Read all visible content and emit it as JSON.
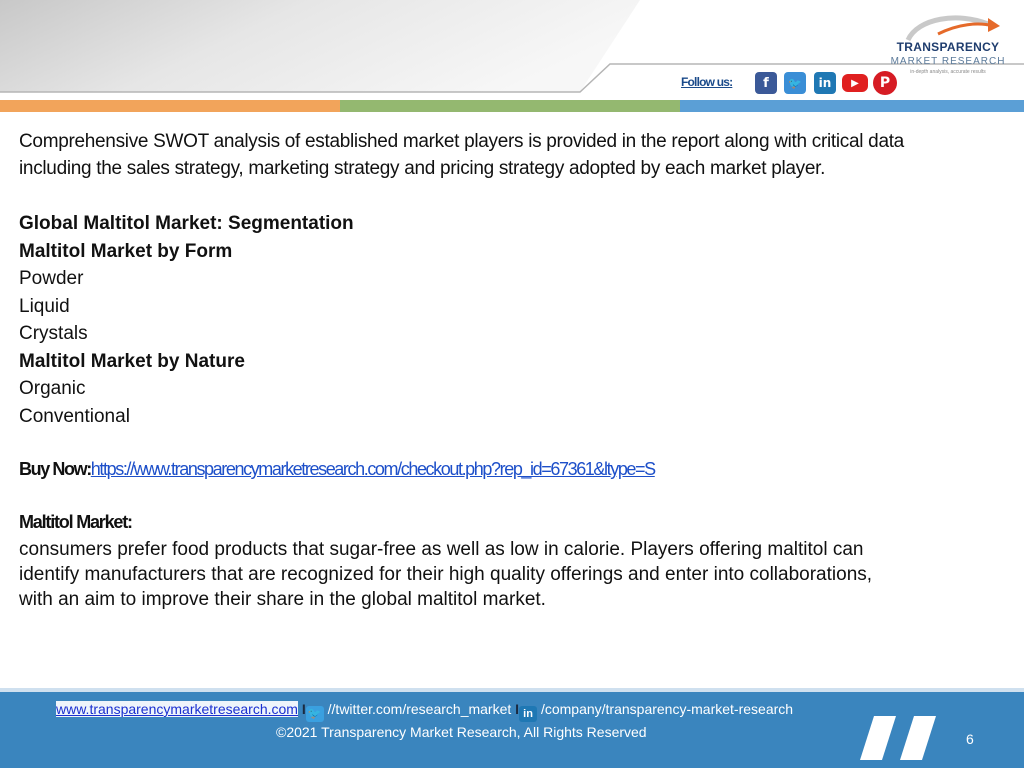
{
  "header": {
    "logo_brand": "TRANSPARENCY",
    "logo_sub": "MARKET RESEARCH",
    "logo_tagline": "in-depth analysis, accurate results",
    "follow_label": "Follow us:",
    "social_icons": [
      "facebook-icon",
      "twitter-icon",
      "linkedin-icon",
      "youtube-icon",
      "pinterest-icon"
    ]
  },
  "colors": {
    "stripe_orange": "#f2a45b",
    "stripe_green": "#94b870",
    "stripe_blue": "#5b9fd6",
    "footer_blue": "#3a85be",
    "brand_navy": "#1f3d6e"
  },
  "body": {
    "intro_line1": "Comprehensive SWOT analysis of established market players is provided in the report along with  critical data",
    "intro_line2": "including the sales strategy, marketing strategy and pricing strategy adopted by each   market player.",
    "segmentation_title": "Global Maltitol Market: Segmentation",
    "by_form_title": "Maltitol Market by Form",
    "form_items": [
      "Powder",
      "Liquid",
      "Crystals"
    ],
    "by_nature_title": "Maltitol Market by Nature",
    "nature_items": [
      "Organic",
      "Conventional"
    ],
    "buy_label": "Buy Now:",
    "buy_link": "https://www.transparencymarketresearch.com/checkout.php?rep_id=67361&ltype=S",
    "market_title": "Maltitol Market:",
    "market_line1": "consumers prefer food products that sugar-free as well as low in calorie. Players offering maltitol can",
    "market_line2": "identify manufacturers that are recognized for their high quality offerings and enter into collaborations,",
    "market_line3": "with an aim to improve their share in the global maltitol market."
  },
  "footer": {
    "site_link": "www.transparencymarketresearch.com",
    "separator": "I",
    "twitter_text": "//twitter.com/research_market",
    "linkedin_text": "/company/transparency-market-research",
    "copyright": "©2021 Transparency Market Research, All Rights Reserved",
    "page_number": "6"
  }
}
